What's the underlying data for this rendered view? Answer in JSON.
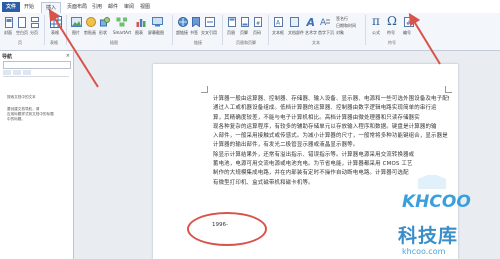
{
  "ribbon": {
    "tabs": [
      "文件",
      "开始",
      "插入",
      "页面布局",
      "引用",
      "邮件",
      "审阅",
      "视图"
    ],
    "active_tab": "插入",
    "groups": [
      "页",
      "表格",
      "插图",
      "链接",
      "页眉和页脚",
      "文本",
      "符号"
    ],
    "buttons": {
      "cover": "封面",
      "blank": "空白页",
      "break": "分页",
      "table": "表格",
      "picture": "图片",
      "clipart": "剪贴画",
      "shapes": "形状",
      "smartart": "SmartArt",
      "chart": "图表",
      "screenshot": "屏幕截图",
      "hyperlink": "超链接",
      "bookmark": "书签",
      "crossref": "交叉引用",
      "header": "页眉",
      "footer": "页脚",
      "pagenum": "页码",
      "textbox": "文本框",
      "quickparts": "文档部件",
      "wordart": "艺术字",
      "dropcap": "首字下沉",
      "signature": "签名行",
      "datetime": "日期和时间",
      "object": "对象",
      "equation": "公式",
      "symbol": "符号",
      "number": "编号"
    }
  },
  "nav": {
    "title": "导航",
    "line1": "搜索文档中的文本",
    "line2a": "要创建文档导航，请",
    "line2b": "应用标题样式到文档中的标题",
    "line2c": "中的标题。"
  },
  "document": {
    "lines": [
      "计算器一般由运算器、控制器、存储器、输入设备、显示器、电源和一些可选外围设备及电子配件",
      "通过人工或机器设备组成。低档计算器的运算器、控制器由数字逻辑电路实现简单的串行运",
      "算，其精确度较差，不能与电子计算机相比。高档计算器由微处理器和只读存储器实",
      "现各种复杂的运算程序，有较多的辅助存储单元以存放输入程序和数据。键盘是计算器的输",
      "入部件，一般采用接触式或传感式。为减小计算器的尺寸，一般常将多种功能键组合，显示器是",
      "计算器的输出部件，有发光二极管显示器或液晶显示器等。",
      "除显示计算结果外，还常有溢出指示、错误指示等。计算器电源采用交流转换器或",
      "蓄电池，电源可用交流电源或电池充电。为节省电能，计算器都采用 CMOS 工艺",
      "制作的大规模集成电路，并在内部装有定时不操作自动断电电路。计算器可选配",
      "有微型打印机、盒式磁带机和磁卡机等。"
    ],
    "year": "1996-"
  },
  "watermark": {
    "logo": "KHCOO",
    "name": "科技库",
    "url": "khcoo.com"
  },
  "colors": {
    "accent": "#2a5fa8",
    "arrow": "#d8534a",
    "watermark": "#3a8fc9"
  }
}
